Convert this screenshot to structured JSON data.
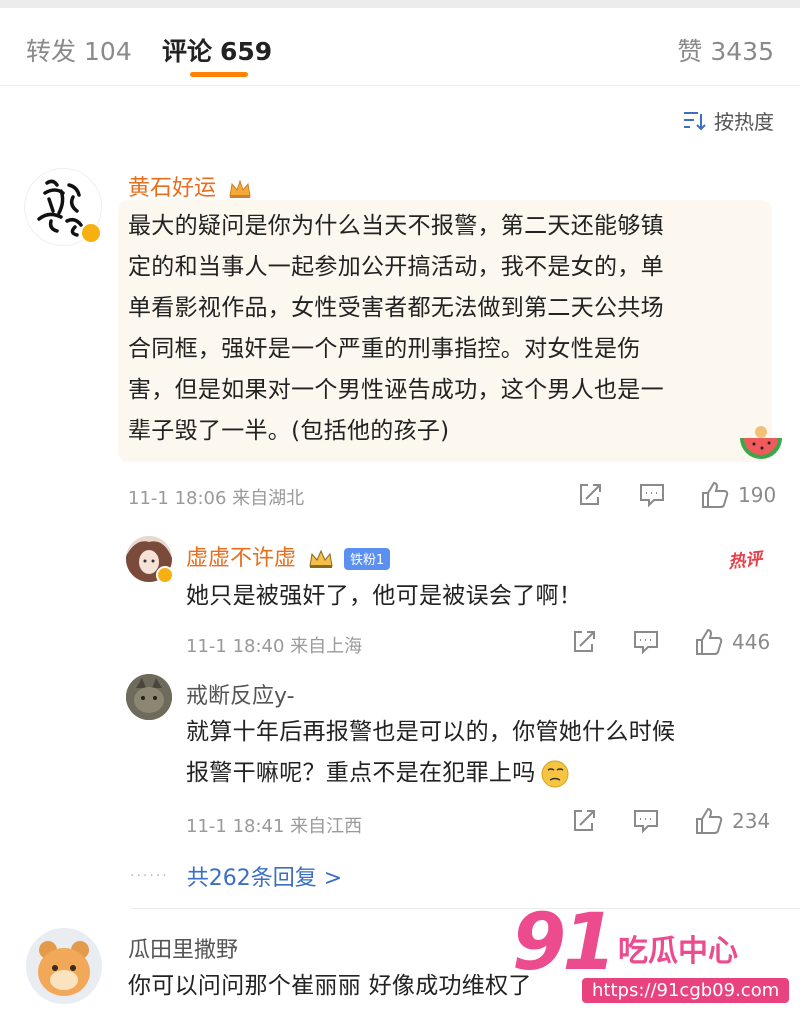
{
  "tabs": {
    "repost_label": "转发",
    "repost_count": "104",
    "comments_label": "评论",
    "comments_count": "659",
    "likes_label": "赞",
    "likes_count": "3435",
    "accent_color": "#ff8200"
  },
  "sort": {
    "label": "按热度",
    "icon": "sort-icon"
  },
  "comments": [
    {
      "username": "黄石好运",
      "text_lines": [
        "最大的疑问是你为什么当天不报警，第二天还能够镇",
        "定的和当事人一起参加公开搞活动，我不是女的，单",
        "单看影视作品，女性受害者都无法做到第二天公共场",
        "合同框，强奸是一个严重的刑事指控。对女性是伤",
        "害，但是如果对一个男性诬告成功，这个男人也是一",
        "辈子毁了一半。(包括他的孩子)"
      ],
      "meta": "11-1 18:06 来自湖北",
      "likes": "190",
      "replies": [
        {
          "username": "虚虚不许虚",
          "fan_badge": "铁粉1",
          "hot_badge": "热评",
          "text_lines": [
            "她只是被强奸了，他可是被误会了啊！"
          ],
          "meta": "11-1 18:40 来自上海",
          "likes": "446"
        },
        {
          "username": "戒断反应y-",
          "text_lines": [
            "就算十年后再报警也是可以的，你管她什么时候",
            "报警干嘛呢？重点不是在犯罪上吗"
          ],
          "meta": "11-1 18:41 来自江西",
          "likes": "234"
        }
      ],
      "more_replies": "共262条回复 >"
    },
    {
      "username": "瓜田里撒野",
      "text_lines": [
        "你可以问问那个崔丽丽 好像成功维权了"
      ]
    }
  ],
  "watermark": {
    "number": "91",
    "text": "吃瓜中心",
    "url": "https://91cgb09.com"
  }
}
